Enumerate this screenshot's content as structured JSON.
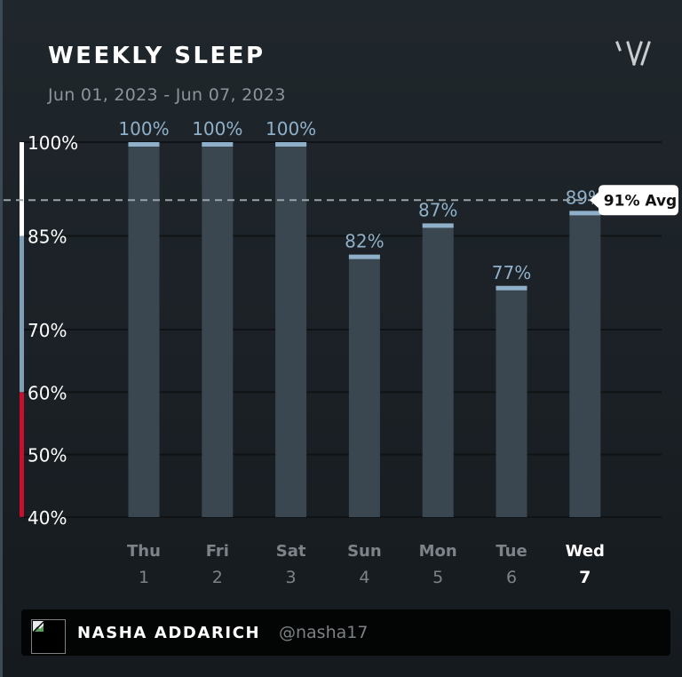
{
  "header": {
    "title": "WEEKLY SLEEP",
    "date_range": "Jun 01, 2023 - Jun 07, 2023",
    "logo_icon": "whoop-logo-icon"
  },
  "colors": {
    "bar_fill": "#3a4750",
    "bar_cap": "#8fb0c8",
    "value_label": "#8fb0c8",
    "tick_label": "#ffffff",
    "day_label": "#7d8389",
    "day_label_active": "#ffffff",
    "gridline": "#0f1315",
    "avg_line": "#9aa3aa",
    "scale_white": "#ffffff",
    "scale_blue": "#7f9fb7",
    "scale_red": "#c8102e"
  },
  "chart_data": {
    "type": "bar",
    "title": "WEEKLY SLEEP",
    "subtitle": "Jun 01, 2023 - Jun 07, 2023",
    "xlabel": "",
    "ylabel": "",
    "ylim": [
      40,
      100
    ],
    "yticks": [
      100,
      85,
      70,
      60,
      50,
      40
    ],
    "ytick_labels": [
      "100%",
      "85%",
      "70%",
      "60%",
      "50%",
      "40%"
    ],
    "grid": true,
    "categories": [
      "Thu",
      "Fri",
      "Sat",
      "Sun",
      "Mon",
      "Tue",
      "Wed"
    ],
    "day_numbers": [
      "1",
      "2",
      "3",
      "4",
      "5",
      "6",
      "7"
    ],
    "active_index": 6,
    "values": [
      100,
      100,
      100,
      82,
      87,
      77,
      89
    ],
    "value_labels": [
      "100%",
      "100%",
      "100%",
      "82%",
      "87%",
      "77%",
      "89%"
    ],
    "average": 91,
    "average_label": "91% Avg",
    "scale_bands": [
      {
        "from": 85,
        "to": 100,
        "color": "#ffffff"
      },
      {
        "from": 60,
        "to": 85,
        "color": "#7f9fb7"
      },
      {
        "from": 40,
        "to": 60,
        "color": "#c8102e"
      }
    ]
  },
  "footer": {
    "name": "NASHA ADDARICH",
    "handle": "@nasha17",
    "avatar_icon": "broken-image-icon"
  }
}
